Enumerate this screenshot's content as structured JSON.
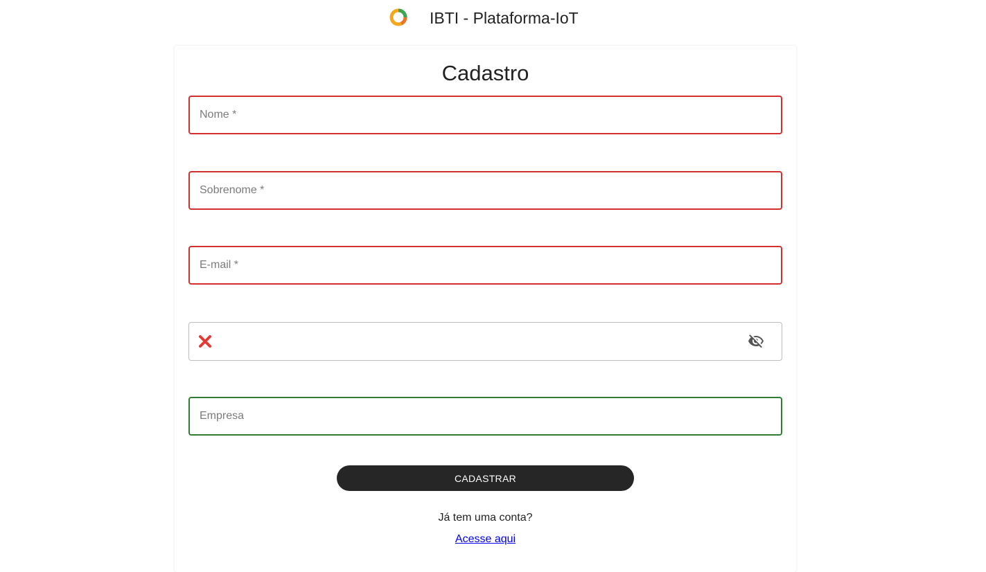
{
  "header": {
    "app_title": "IBTI - Plataforma-IoT",
    "logo_icon": "ring-logo-icon"
  },
  "form": {
    "title": "Cadastro",
    "fields": {
      "nome": {
        "placeholder": "Nome *",
        "value": "",
        "state": "error"
      },
      "sobrenome": {
        "placeholder": "Sobrenome *",
        "value": "",
        "state": "error"
      },
      "email": {
        "placeholder": "E-mail *",
        "value": "",
        "state": "error"
      },
      "password": {
        "placeholder": "",
        "value": "",
        "state": "invalid",
        "status_icon": "x-mark-icon",
        "toggle_icon": "eye-off-icon"
      },
      "empresa": {
        "placeholder": "Empresa",
        "value": "",
        "state": "valid"
      }
    },
    "submit_label": "CADASTRAR",
    "have_account_text": "Já tem uma conta?",
    "login_link_text": "Acesse aqui"
  },
  "colors": {
    "error": "#d32f2f",
    "valid": "#2e7d32",
    "button_bg": "#262626",
    "link": "#0000ee"
  }
}
